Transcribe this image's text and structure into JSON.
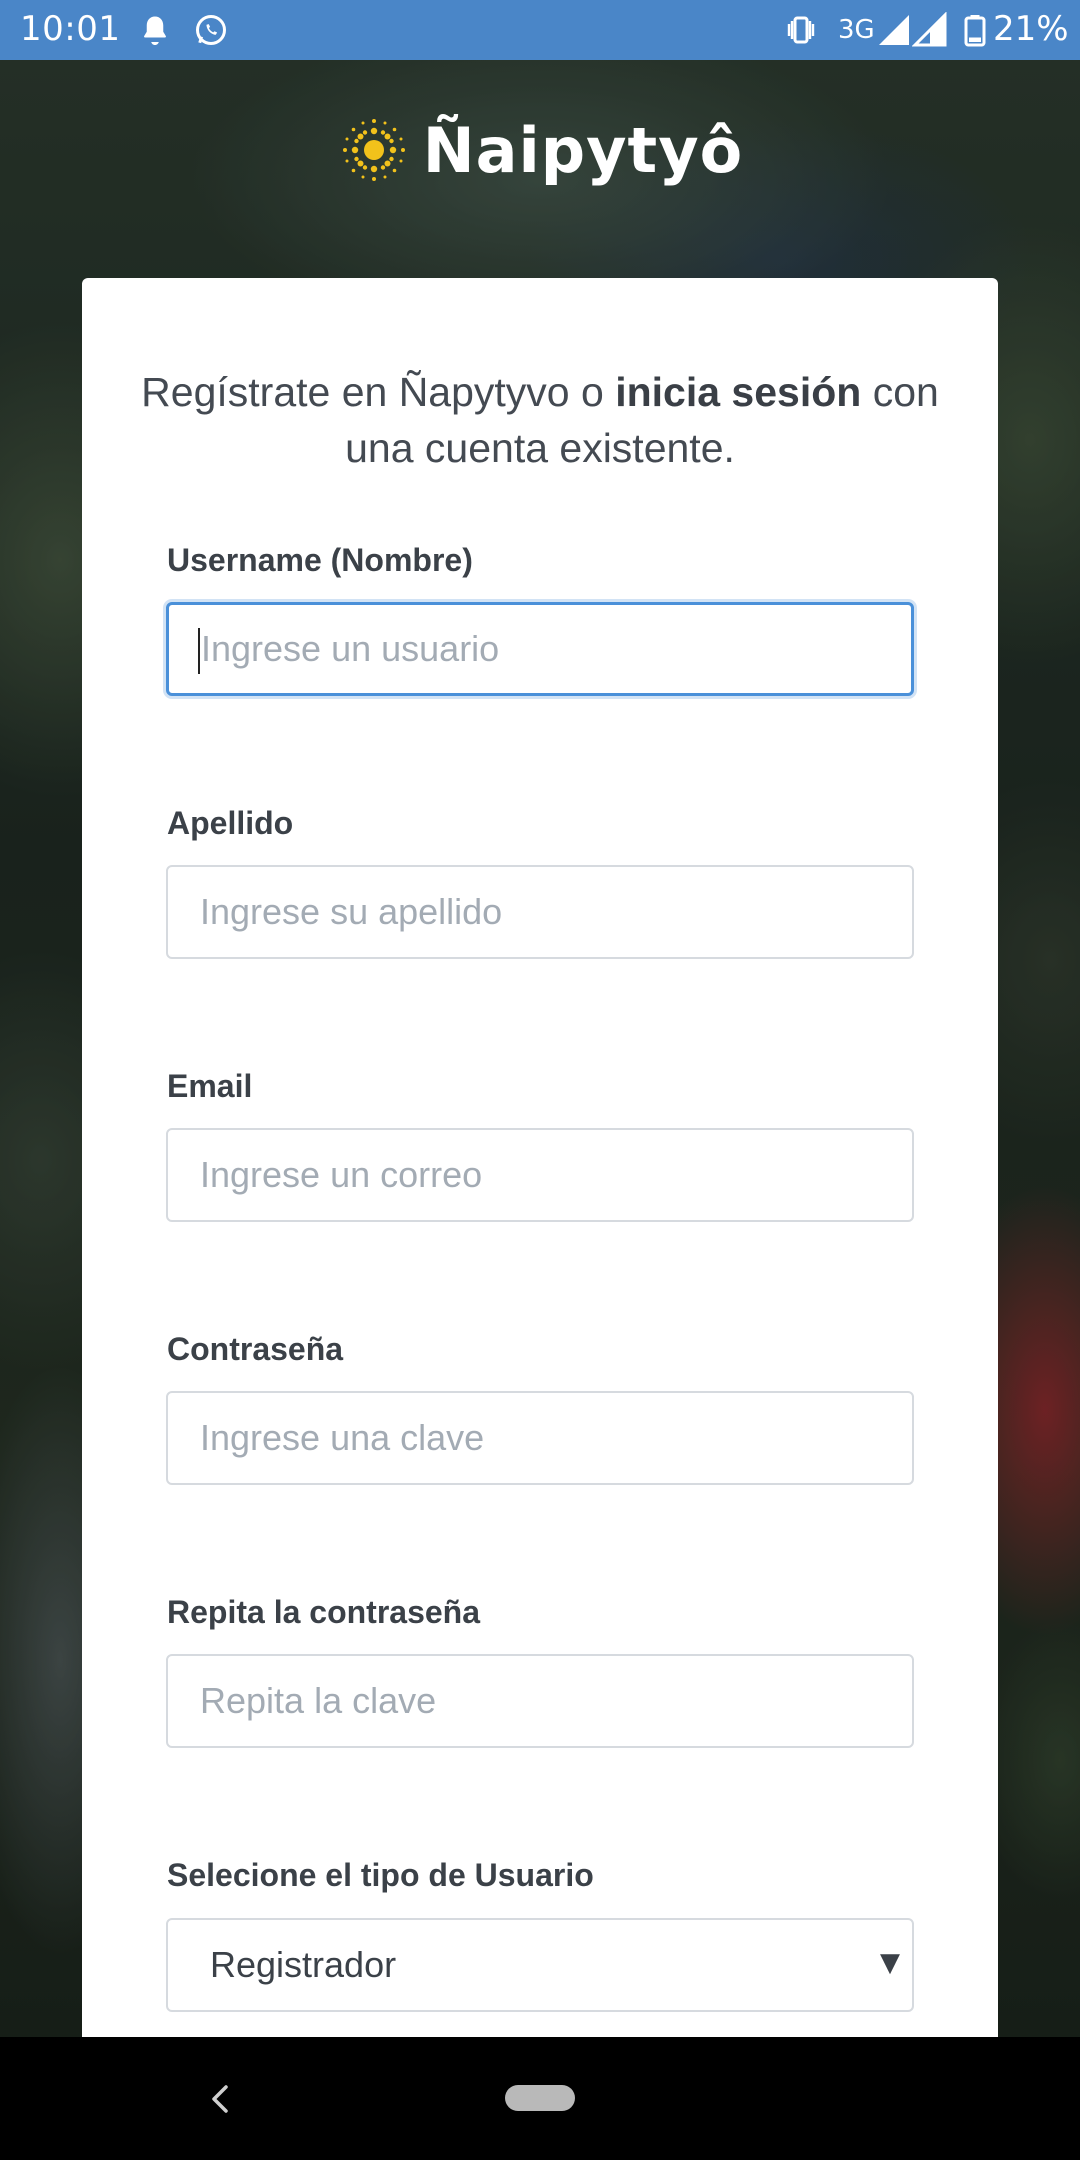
{
  "status_bar": {
    "time": "10:01",
    "network": "3G",
    "battery": "21%",
    "color": "#4a86c8"
  },
  "header": {
    "app_name": "Ñaipytyô",
    "logo_icon": "sun-icon"
  },
  "intro": {
    "text_before": "Regístrate en Ñapytyvo o ",
    "link_text": "inicia sesión",
    "text_after": " con una cuenta existente."
  },
  "form": {
    "username": {
      "label": "Username (Nombre)",
      "placeholder": "Ingrese un usuario",
      "value": ""
    },
    "apellido": {
      "label": "Apellido",
      "placeholder": "Ingrese su apellido",
      "value": ""
    },
    "email": {
      "label": "Email",
      "placeholder": "Ingrese un correo",
      "value": ""
    },
    "password": {
      "label": "Contraseña",
      "placeholder": "Ingrese una clave",
      "value": ""
    },
    "password_repeat": {
      "label": "Repita la contraseña",
      "placeholder": "Repita la clave",
      "value": ""
    },
    "user_type": {
      "label": "Selecione el tipo de Usuario",
      "selected": "Registrador",
      "arrow": "▼"
    }
  },
  "colors": {
    "accent": "#4a90d9",
    "card": "#ffffff",
    "label": "#3b4148",
    "placeholder": "#a3abb4"
  }
}
